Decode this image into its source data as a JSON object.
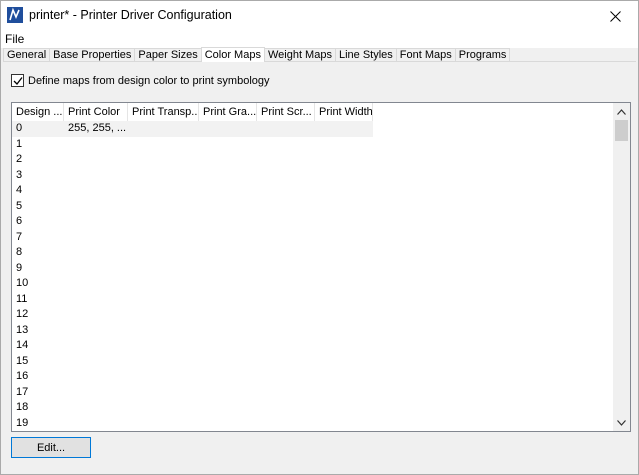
{
  "window": {
    "title": "printer* - Printer Driver Configuration",
    "close_glyph": "✕",
    "icon": "printer-driver-app-icon"
  },
  "menu": {
    "file": "File"
  },
  "tabs": [
    {
      "label": "General",
      "active": false
    },
    {
      "label": "Base Properties",
      "active": false
    },
    {
      "label": "Paper Sizes",
      "active": false
    },
    {
      "label": "Color Maps",
      "active": true
    },
    {
      "label": "Weight Maps",
      "active": false
    },
    {
      "label": "Line Styles",
      "active": false
    },
    {
      "label": "Font Maps",
      "active": false
    },
    {
      "label": "Programs",
      "active": false
    }
  ],
  "checkbox": {
    "label": "Define maps from design color to print symbology",
    "checked": true
  },
  "table": {
    "columns": [
      "Design ...",
      "Print Color",
      "Print Transp...",
      "Print Gra...",
      "Print Scr...",
      "Print Width"
    ],
    "rows": [
      [
        "0",
        "255, 255, ..."
      ],
      [
        "1",
        ""
      ],
      [
        "2",
        ""
      ],
      [
        "3",
        ""
      ],
      [
        "4",
        ""
      ],
      [
        "5",
        ""
      ],
      [
        "6",
        ""
      ],
      [
        "7",
        ""
      ],
      [
        "8",
        ""
      ],
      [
        "9",
        ""
      ],
      [
        "10",
        ""
      ],
      [
        "11",
        ""
      ],
      [
        "12",
        ""
      ],
      [
        "13",
        ""
      ],
      [
        "14",
        ""
      ],
      [
        "15",
        ""
      ],
      [
        "16",
        ""
      ],
      [
        "17",
        ""
      ],
      [
        "18",
        ""
      ],
      [
        "19",
        ""
      ]
    ]
  },
  "buttons": {
    "edit": "Edit..."
  }
}
